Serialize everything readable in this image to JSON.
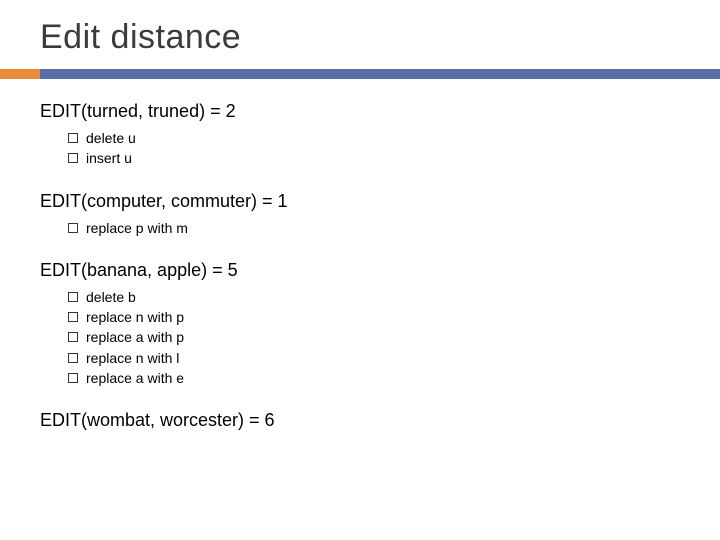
{
  "title": "Edit distance",
  "blocks": [
    {
      "heading": "EDIT(turned, truned) = 2",
      "items": [
        "delete u",
        "insert u"
      ]
    },
    {
      "heading": "EDIT(computer, commuter) = 1",
      "items": [
        "replace p with m"
      ]
    },
    {
      "heading": "EDIT(banana, apple) = 5",
      "items": [
        "delete b",
        "replace n with p",
        "replace a with p",
        "replace n with l",
        "replace a with e"
      ]
    },
    {
      "heading": "EDIT(wombat, worcester) = 6",
      "items": []
    }
  ]
}
